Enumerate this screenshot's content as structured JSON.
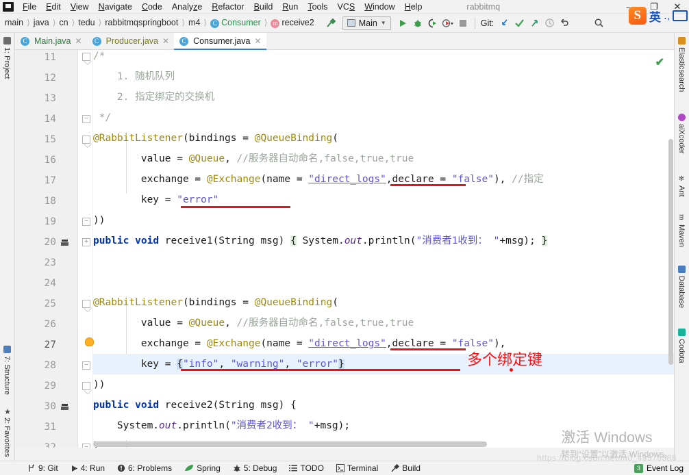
{
  "window": {
    "project_name": "rabbitmq",
    "minimize": "—",
    "maximize": "❐",
    "close": "✕"
  },
  "menubar": {
    "items": [
      {
        "label": "File",
        "mnemonic": "F"
      },
      {
        "label": "Edit",
        "mnemonic": "E"
      },
      {
        "label": "View",
        "mnemonic": "V"
      },
      {
        "label": "Navigate",
        "mnemonic": "N"
      },
      {
        "label": "Code",
        "mnemonic": "C"
      },
      {
        "label": "Analyze",
        "mnemonic": "z"
      },
      {
        "label": "Refactor",
        "mnemonic": "R"
      },
      {
        "label": "Build",
        "mnemonic": "B"
      },
      {
        "label": "Run",
        "mnemonic": "R"
      },
      {
        "label": "Tools",
        "mnemonic": "T"
      },
      {
        "label": "VCS",
        "mnemonic": "S"
      },
      {
        "label": "Window",
        "mnemonic": "W"
      },
      {
        "label": "Help",
        "mnemonic": "H"
      }
    ]
  },
  "breadcrumb": {
    "items": [
      "main",
      "java",
      "cn",
      "tedu",
      "rabbitmqspringboot",
      "m4"
    ],
    "class_badge": "C",
    "class_name": "Consumer",
    "method_badge": "m",
    "method_name": "receive2"
  },
  "toolbar": {
    "run_config": "Main",
    "git_label": "Git:",
    "icons": [
      "build-hammer-icon",
      "run-icon",
      "debug-icon",
      "run-coverage-icon",
      "profile-icon",
      "stop-icon",
      "git-update-icon",
      "git-commit-icon",
      "git-push-icon",
      "git-history-icon",
      "git-rollback-icon",
      "search-everywhere-icon"
    ]
  },
  "ime": {
    "logo": "S",
    "mode": "英",
    "dots": "․,",
    "keyboard_icon": "keyboard-icon"
  },
  "tabs": [
    {
      "label": "Main.java",
      "badge": "C",
      "active": false
    },
    {
      "label": "Producer.java",
      "badge": "C",
      "active": false
    },
    {
      "label": "Consumer.java",
      "badge": "C",
      "active": true
    }
  ],
  "left_strip": [
    {
      "label": "1: Project",
      "mnemonic": "1"
    },
    {
      "label": "7: Structure",
      "mnemonic": "7"
    },
    {
      "label": "2: Favorites",
      "mnemonic": "2"
    }
  ],
  "right_strip": [
    {
      "label": "Elasticsearch",
      "color": "#d98f1e"
    },
    {
      "label": "aiXcoder",
      "color": "#b148c8"
    },
    {
      "label": "Ant",
      "color": "#4a4a4a"
    },
    {
      "label": "Maven",
      "color": "#2b2b2b"
    },
    {
      "label": "Database",
      "color": "#4b7fbf"
    },
    {
      "label": "Codota",
      "color": "#16b39a"
    }
  ],
  "editor": {
    "lines": [
      {
        "num": "11",
        "text": "/*"
      },
      {
        "num": "12",
        "text": "    1. 随机队列"
      },
      {
        "num": "13",
        "text": "    2. 指定绑定的交换机"
      },
      {
        "num": "14",
        "text": " */"
      },
      {
        "num": "15",
        "text": "@RabbitListener(bindings = @QueueBinding("
      },
      {
        "num": "16",
        "text": "        value = @Queue, //服务器自动命名,false,true,true"
      },
      {
        "num": "17",
        "text": "        exchange = @Exchange(name = \"direct_logs\",declare = \"false\"), //指定"
      },
      {
        "num": "18",
        "text": "        key = \"error\""
      },
      {
        "num": "19",
        "text": "))"
      },
      {
        "num": "20",
        "text": "public void receive1(String msg) { System.out.println(\"消费者1收到： \"+msg); }"
      },
      {
        "num": "23",
        "text": ""
      },
      {
        "num": "24",
        "text": "@RabbitListener(bindings = @QueueBinding("
      },
      {
        "num": "25",
        "text": "        value = @Queue, //服务器自动命名,false,true,true"
      },
      {
        "num": "26",
        "text": "        exchange = @Exchange(name = \"direct_logs\",declare = \"false\"),"
      },
      {
        "num": "27",
        "text": "        key = {\"info\", \"warning\", \"error\"}"
      },
      {
        "num": "28",
        "text": "))"
      },
      {
        "num": "29",
        "text": "public void receive2(String msg) {"
      },
      {
        "num": "30",
        "text": "    System.out.println(\"消费者2收到： \"+msg);"
      },
      {
        "num": "31",
        "text": "}"
      },
      {
        "num": "32",
        "text": ""
      }
    ],
    "current_line": "27",
    "inspection_status": "✔"
  },
  "annotation": {
    "note": "多个绑定键",
    "color": "#ff1111"
  },
  "watermark": {
    "line1": "激活 Windows",
    "line2": "转到“设置”以激活 Windows。"
  },
  "statusbar": {
    "items": [
      {
        "label": "9: Git",
        "mnemonic": "9",
        "icon": "git-branch-icon"
      },
      {
        "label": "4: Run",
        "mnemonic": "4",
        "icon": "run-icon"
      },
      {
        "label": "6: Problems",
        "mnemonic": "6",
        "icon": "problems-icon"
      },
      {
        "label": "Spring",
        "mnemonic": "",
        "icon": "spring-leaf-icon"
      },
      {
        "label": "5: Debug",
        "mnemonic": "5",
        "icon": "debug-bug-icon"
      },
      {
        "label": "TODO",
        "mnemonic": "",
        "icon": "todo-list-icon"
      },
      {
        "label": "Terminal",
        "mnemonic": "",
        "icon": "terminal-icon"
      },
      {
        "label": "Build",
        "mnemonic": "",
        "icon": "build-hammer-icon"
      }
    ],
    "event_log": "Event Log",
    "event_count": "3"
  }
}
